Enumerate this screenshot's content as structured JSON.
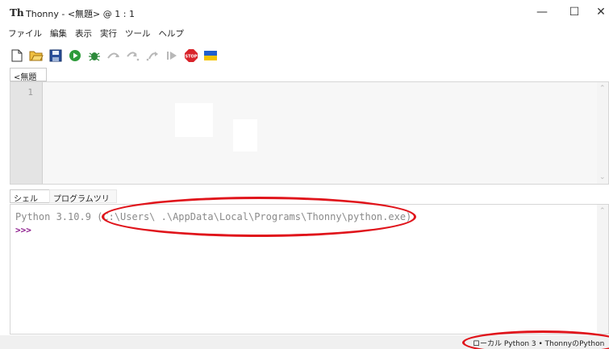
{
  "window": {
    "title": "Thonny  -  <無題>  @  1 : 1",
    "logo_text": "Th",
    "minimize_glyph": "—",
    "maximize_glyph": "☐",
    "close_glyph": "✕"
  },
  "menu": [
    "ファイル",
    "編集",
    "表示",
    "実行",
    "ツール",
    "ヘルプ"
  ],
  "toolbar_icons": [
    "new-file-icon",
    "open-folder-icon",
    "save-icon",
    "run-icon",
    "debug-icon",
    "step-over-icon",
    "step-into-icon",
    "step-out-icon",
    "resume-icon",
    "stop-icon",
    "ukraine-flag-icon"
  ],
  "editor": {
    "tab_label": "<無題>",
    "tab_close": "×",
    "line_number": "1"
  },
  "shell": {
    "tab_label": "シェル",
    "tab_close": "×",
    "program_tree_label": "プログラムツリー",
    "program_tree_close": "×",
    "banner": "Python 3.10.9 (C:\\Users\\       .\\AppData\\Local\\Programs\\Thonny\\python.exe)",
    "prompt": ">>>"
  },
  "status": {
    "text": "ローカル Python 3  •  ThonnyのPython"
  },
  "colors": {
    "annotation": "#e0141b",
    "prompt": "#8c1a8c",
    "run_green": "#2d9b3a",
    "stop_red": "#d9232a",
    "flag_blue": "#1f5fd0",
    "flag_yellow": "#f5c400"
  }
}
